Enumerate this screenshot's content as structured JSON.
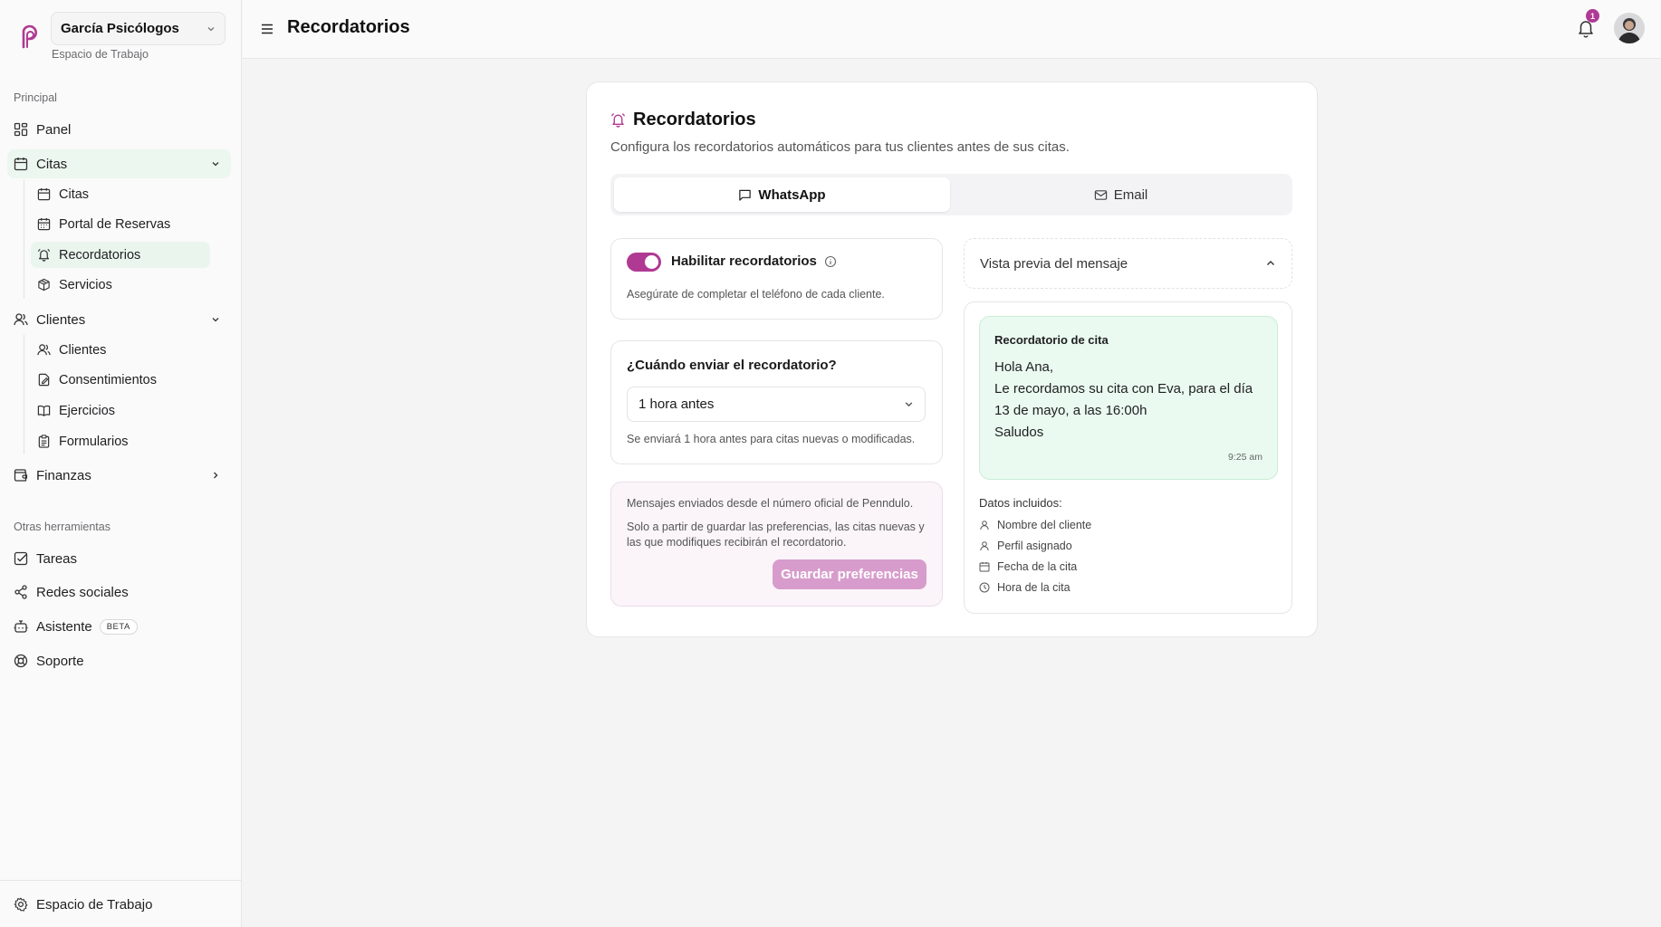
{
  "workspace": {
    "name": "García Psicólogos",
    "subtitle": "Espacio de Trabajo"
  },
  "sidebar": {
    "section_main": "Principal",
    "panel": "Panel",
    "citas_group": "Citas",
    "citas_sub": [
      "Citas",
      "Portal de Reservas",
      "Recordatorios",
      "Servicios"
    ],
    "clientes_group": "Clientes",
    "clientes_sub": [
      "Clientes",
      "Consentimientos",
      "Ejercicios",
      "Formularios"
    ],
    "finanzas": "Finanzas",
    "section_tools": "Otras herramientas",
    "tareas": "Tareas",
    "redes": "Redes sociales",
    "asistente": "Asistente",
    "beta": "BETA",
    "soporte": "Soporte",
    "footer": "Espacio de Trabajo"
  },
  "header": {
    "title": "Recordatorios",
    "notification_count": "1"
  },
  "card": {
    "title": "Recordatorios",
    "description": "Configura los recordatorios automáticos para tus clientes antes de sus citas.",
    "tabs": [
      {
        "label": "WhatsApp",
        "active": true
      },
      {
        "label": "Email",
        "active": false
      }
    ],
    "enable": {
      "label": "Habilitar recordatorios",
      "enabled": true,
      "hint": "Asegúrate de completar el teléfono de cada cliente."
    },
    "when": {
      "label": "¿Cuándo enviar el recordatorio?",
      "selected": "1 hora antes",
      "hint": "Se enviará 1 hora antes para citas nuevas o modificadas."
    },
    "info": {
      "line1": "Mensajes enviados desde el número oficial de Penndulo.",
      "line2": "Solo a partir de guardar las preferencias, las citas nuevas y las que modifiques recibirán el recordatorio.",
      "save": "Guardar preferencias"
    },
    "preview": {
      "header": "Vista previa del mensaje",
      "bubble_title": "Recordatorio de cita",
      "greeting": "Hola Ana,",
      "body": "Le recordamos su cita con Eva, para el día 13 de mayo, a las 16:00h",
      "closing": "Saludos",
      "time": "9:25 am",
      "included_title": "Datos incluidos:",
      "included": [
        "Nombre del cliente",
        "Perfil asignado",
        "Fecha de la cita",
        "Hora de la cita"
      ]
    }
  },
  "colors": {
    "accent": "#b03a93",
    "accent_light": "#d79ccc",
    "preview_bg": "#eafaf0",
    "active_nav": "#ecf7ef"
  }
}
